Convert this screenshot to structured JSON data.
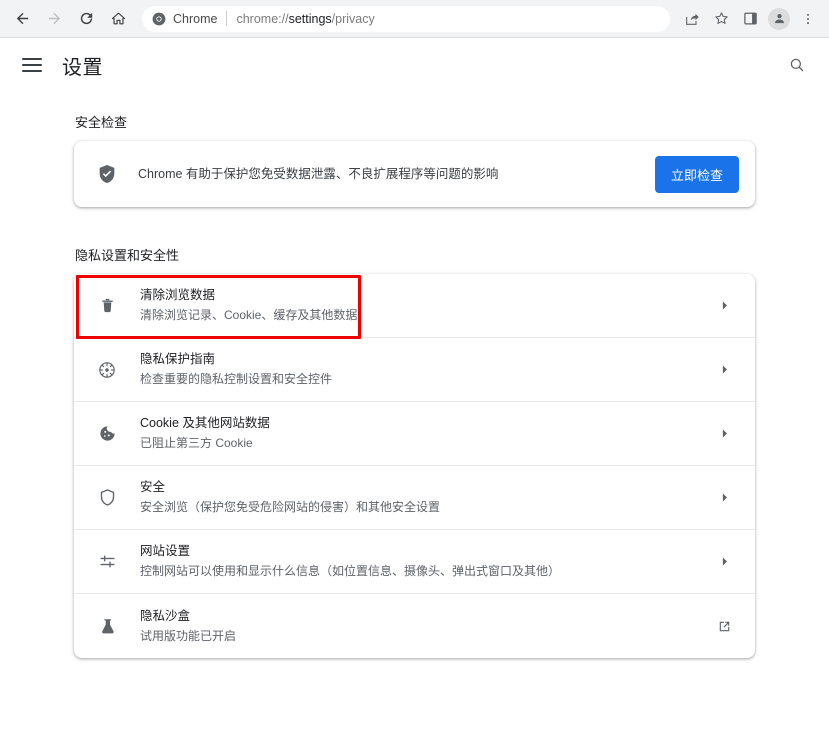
{
  "browser": {
    "nav": {
      "back": "back-arrow",
      "forward": "forward-arrow",
      "reload": "reload",
      "home": "home"
    },
    "omnibox": {
      "site_name": "Chrome",
      "url_prefix": "chrome://",
      "url_strong": "settings",
      "url_suffix": "/privacy",
      "full_url": "chrome://settings/privacy"
    },
    "toolbar_icons": [
      "share-icon",
      "star-icon",
      "side-panel-icon",
      "profile-avatar",
      "more-menu-icon"
    ]
  },
  "header": {
    "menu_label": "menu",
    "title": "设置",
    "search_label": "search"
  },
  "safety_check": {
    "section_title": "安全检查",
    "description": "Chrome 有助于保护您免受数据泄露、不良扩展程序等问题的影响",
    "button_label": "立即检查",
    "icon": "shield-check-icon",
    "button_color": "#1a73e8"
  },
  "privacy": {
    "section_title": "隐私设置和安全性",
    "highlight_color": "#ee0000",
    "rows": [
      {
        "icon": "trash-icon",
        "title": "清除浏览数据",
        "subtitle": "清除浏览记录、Cookie、缓存及其他数据",
        "action": "chevron-right-icon",
        "highlighted": true
      },
      {
        "icon": "privacy-guide-icon",
        "title": "隐私保护指南",
        "subtitle": "检查重要的隐私控制设置和安全控件",
        "action": "chevron-right-icon",
        "highlighted": false
      },
      {
        "icon": "cookie-icon",
        "title": "Cookie 及其他网站数据",
        "subtitle": "已阻止第三方 Cookie",
        "action": "chevron-right-icon",
        "highlighted": false
      },
      {
        "icon": "shield-outline-icon",
        "title": "安全",
        "subtitle": "安全浏览（保护您免受危险网站的侵害）和其他安全设置",
        "action": "chevron-right-icon",
        "highlighted": false
      },
      {
        "icon": "tune-icon",
        "title": "网站设置",
        "subtitle": "控制网站可以使用和显示什么信息（如位置信息、摄像头、弹出式窗口及其他）",
        "action": "chevron-right-icon",
        "highlighted": false
      },
      {
        "icon": "flask-icon",
        "title": "隐私沙盒",
        "subtitle": "试用版功能已开启",
        "action": "open-in-new-icon",
        "highlighted": false
      }
    ]
  }
}
